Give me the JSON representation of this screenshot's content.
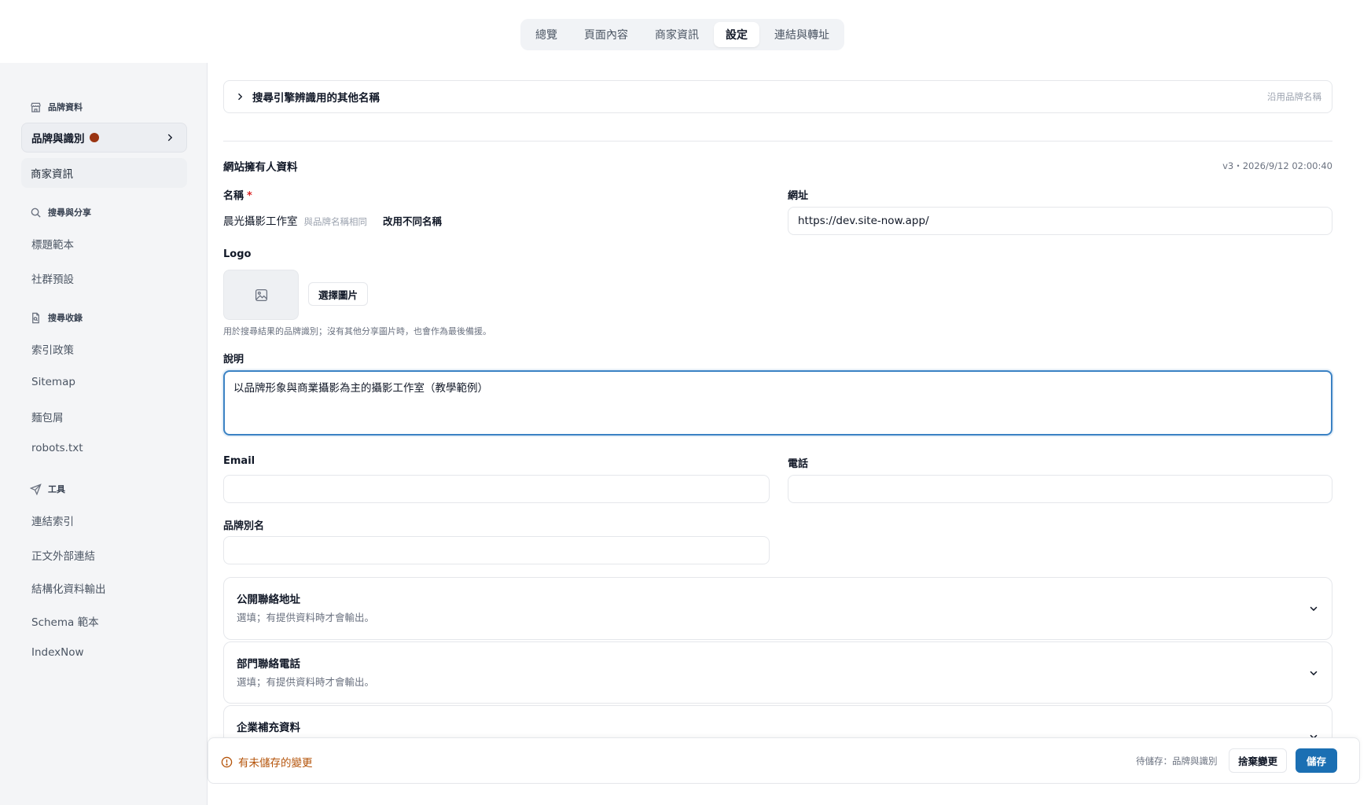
{
  "tabs": [
    {
      "label": "總覽"
    },
    {
      "label": "頁面內容"
    },
    {
      "label": "商家資訊"
    },
    {
      "label": "設定"
    },
    {
      "label": "連結與轉址"
    }
  ],
  "active_tab": "設定",
  "sidebar": {
    "brand_section": {
      "title": "品牌資料",
      "icon": "storefront-icon"
    },
    "brand_identity": {
      "label": "品牌與識別",
      "unsaved_dot_color": "#9a3412"
    },
    "business_info": {
      "label": "商家資訊"
    },
    "search_section": {
      "title": "搜尋與分享",
      "icon": "search-icon"
    },
    "search_items": [
      {
        "label": "標題範本"
      },
      {
        "label": "社群預設"
      }
    ],
    "index_section": {
      "title": "搜尋收錄",
      "icon": "document-search-icon"
    },
    "index_items": [
      {
        "label": "索引政策"
      },
      {
        "label": "Sitemap"
      },
      {
        "label": "麵包屑"
      },
      {
        "label": "robots.txt"
      }
    ],
    "tools_section": {
      "title": "工具",
      "icon": "send-icon"
    },
    "tools_items": [
      {
        "label": "連結索引"
      },
      {
        "label": "正文外部連結"
      },
      {
        "label": "結構化資料輸出"
      },
      {
        "label": "Schema 範本"
      },
      {
        "label": "IndexNow"
      }
    ]
  },
  "main": {
    "alias_collapsible": {
      "label": "搜尋引擎辨識用的其他名稱",
      "right_hint": "沿用品牌名稱"
    },
    "owner_section": {
      "title": "網站擁有人資料",
      "version": "v3・2026/9/12 02:00:40"
    },
    "name": {
      "label": "名稱",
      "required_mark": "*",
      "value": "晨光攝影工作室",
      "hint": "與品牌名稱相同",
      "change_button": "改用不同名稱"
    },
    "url": {
      "label": "網址",
      "value": "https://dev.site-now.app/"
    },
    "logo": {
      "label": "Logo",
      "choose_button": "選擇圖片",
      "help": "用於搜尋結果的品牌識別；沒有其他分享圖片時，也會作為最後備援。"
    },
    "description": {
      "label": "說明",
      "value": "以品牌形象與商業攝影為主的攝影工作室（教學範例）"
    },
    "email": {
      "label": "Email",
      "value": ""
    },
    "phone": {
      "label": "電話",
      "value": ""
    },
    "brand_alias": {
      "label": "品牌別名",
      "value": ""
    },
    "accordions": [
      {
        "title": "公開聯絡地址",
        "subtitle": "選填；有提供資料時才會輸出。"
      },
      {
        "title": "部門聯絡電話",
        "subtitle": "選填；有提供資料時才會輸出。"
      },
      {
        "title": "企業補充資料",
        "subtitle": ""
      }
    ]
  },
  "savebar": {
    "warning": "有未儲存的變更",
    "pending": "待儲存：品牌與識別",
    "discard": "捨棄變更",
    "save": "儲存",
    "accent_color": "#1b6fb3",
    "warning_color": "#b45309"
  }
}
